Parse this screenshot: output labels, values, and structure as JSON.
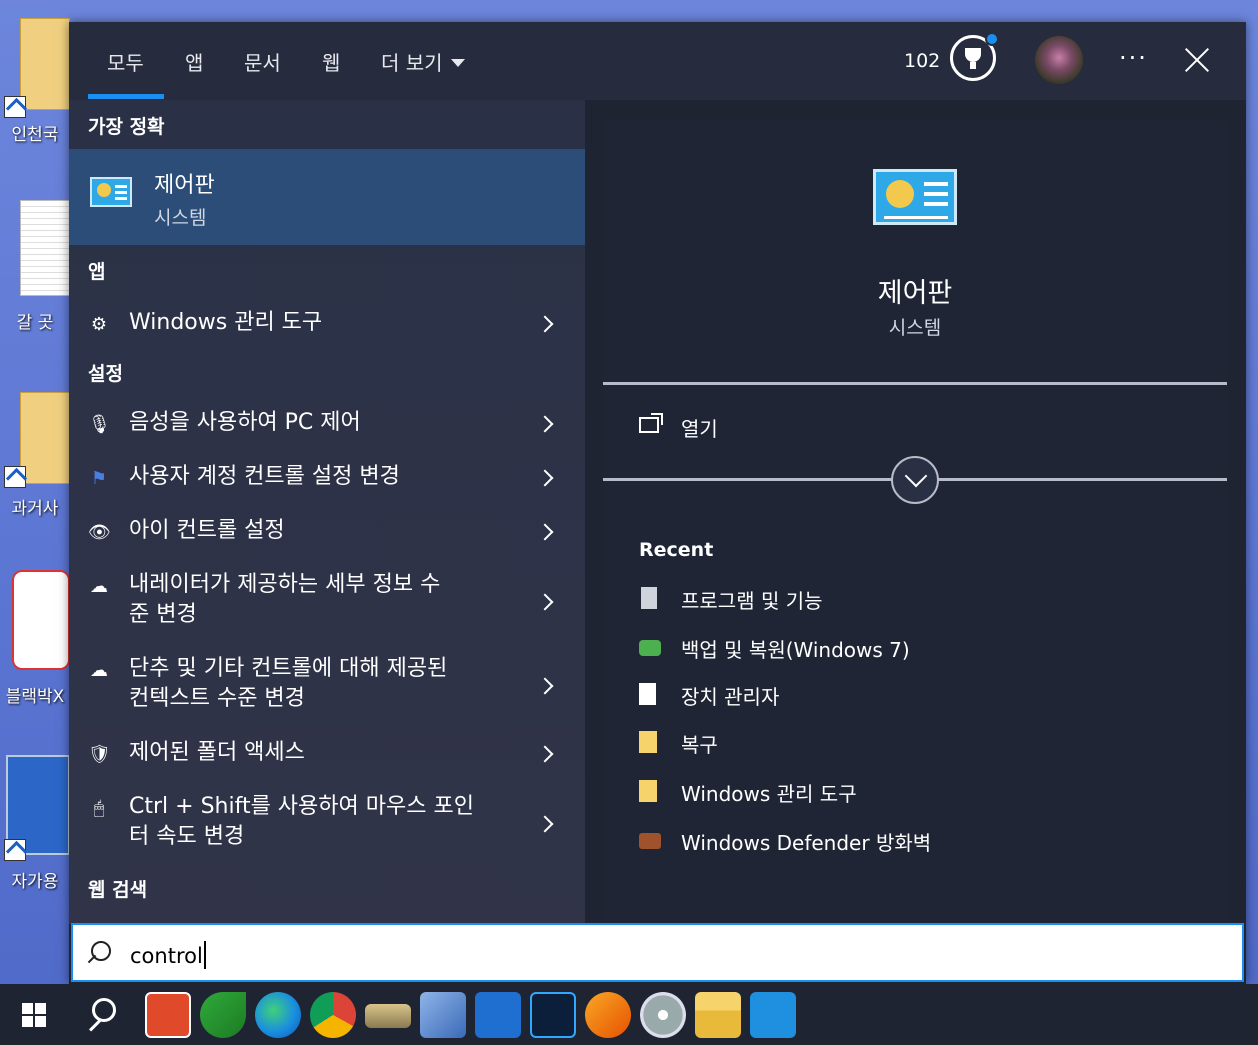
{
  "desktop": {
    "icons": [
      {
        "label": "인천국"
      },
      {
        "label": "갈 곳"
      },
      {
        "label": "과거사"
      },
      {
        "label": "블랙박X"
      },
      {
        "label": "자가용"
      }
    ]
  },
  "tabs": [
    {
      "label": "모두",
      "active": true
    },
    {
      "label": "앱"
    },
    {
      "label": "문서"
    },
    {
      "label": "웹"
    },
    {
      "label": "더 보기"
    }
  ],
  "header": {
    "points": "102",
    "more_label": "···"
  },
  "results": {
    "best_match_heading": "가장 정확",
    "best_match": {
      "title": "제어판",
      "subtitle": "시스템"
    },
    "apps_heading": "앱",
    "apps": [
      {
        "label": "Windows 관리 도구",
        "icon": "admin-tools-icon"
      }
    ],
    "settings_heading": "설정",
    "settings": [
      {
        "label": "음성을 사용하여 PC 제어",
        "icon": "microphone-icon"
      },
      {
        "label": "사용자 계정 컨트롤 설정 변경",
        "icon": "flag-icon"
      },
      {
        "label": "아이 컨트롤 설정",
        "icon": "eye-control-icon"
      },
      {
        "label_line1": "내레이터가 제공하는 세부 정보 수",
        "label_line2": "준 변경",
        "icon": "narrator-icon"
      },
      {
        "label_line1": "단추 및 기타 컨트롤에 대해 제공된",
        "label_line2": "컨텍스트 수준 변경",
        "icon": "narrator-icon"
      },
      {
        "label": "제어된 폴더 액세스",
        "icon": "shield-icon"
      },
      {
        "label_line1": "Ctrl + Shift를 사용하여 마우스 포인",
        "label_line2": "터 속도 변경",
        "icon": "mouse-icon"
      }
    ],
    "web_heading": "웹 검색"
  },
  "detail": {
    "title": "제어판",
    "subtitle": "시스템",
    "open_label": "열기",
    "recent_heading": "Recent",
    "recent": [
      {
        "label": "프로그램 및 기능",
        "icon": "programs-icon"
      },
      {
        "label": "백업 및 복원(Windows 7)",
        "icon": "backup-icon"
      },
      {
        "label": "장치 관리자",
        "icon": "document-icon"
      },
      {
        "label": "복구",
        "icon": "folder-icon"
      },
      {
        "label": "Windows 관리 도구",
        "icon": "folder-icon"
      },
      {
        "label": "Windows Defender 방화벽",
        "icon": "firewall-icon"
      }
    ]
  },
  "search": {
    "query": "control"
  },
  "colors": {
    "accent": "#1b8ff0",
    "best_match_bg": "#2b4d77",
    "panel_bg": "#1f2433"
  }
}
